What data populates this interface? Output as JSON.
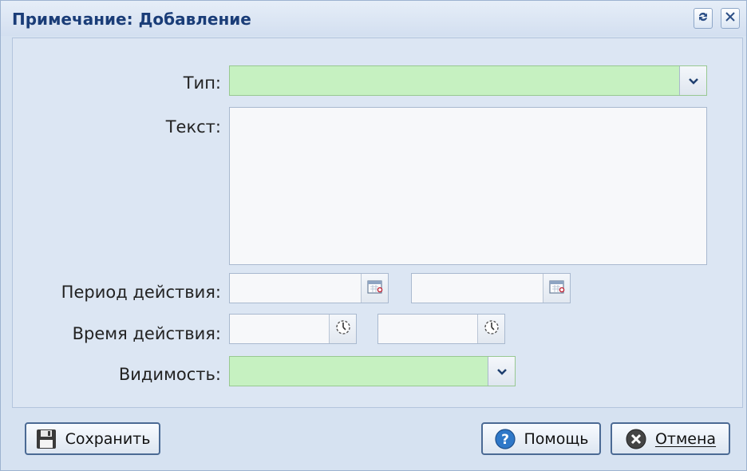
{
  "window": {
    "title": "Примечание: Добавление",
    "refresh_icon": "refresh-icon",
    "close_icon": "close-icon"
  },
  "form": {
    "type_label": "Тип:",
    "type_value": "",
    "text_label": "Текст:",
    "text_value": "",
    "period_label": "Период действия:",
    "period_from": "",
    "period_to": "",
    "time_label": "Время действия:",
    "time_from": "",
    "time_to": "",
    "visibility_label": "Видимость:",
    "visibility_value": ""
  },
  "buttons": {
    "save": "Сохранить",
    "help": "Помощь",
    "cancel": "Отмена"
  },
  "colors": {
    "required_field": "#c6f1c1",
    "title": "#1a3d78"
  }
}
